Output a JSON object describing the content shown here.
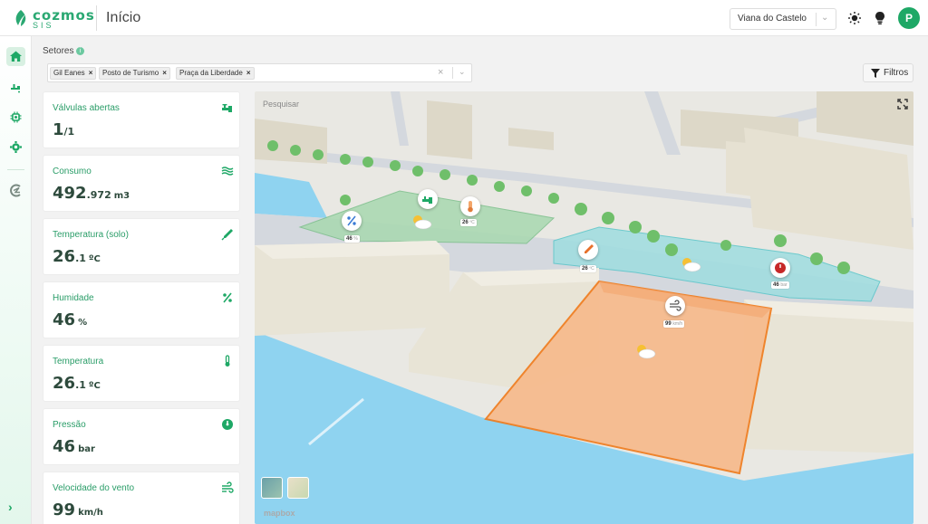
{
  "app": {
    "brand": "cozmos",
    "brand_sub": "SIS",
    "page_title": "Início",
    "user_initial": "P"
  },
  "header": {
    "city": "Viana do Castelo",
    "icons": [
      "sun-icon",
      "lightbulb-icon"
    ]
  },
  "sidebar": {
    "items": [
      "home-icon",
      "irrigation-icon",
      "sensor-icon",
      "settings-icon",
      "cozmos-icon"
    ],
    "expand_icon": "›"
  },
  "filters": {
    "sectors_label": "Setores",
    "info_icon": "i",
    "chips": [
      {
        "label": "Gil Eanes",
        "remove": "×"
      },
      {
        "label": "Posto de Turismo",
        "remove": "×"
      },
      {
        "label": "Praça da Liberdade",
        "remove": "×"
      }
    ],
    "clear": "×",
    "chevron": "⌄",
    "filters_button": "Filtros"
  },
  "cards": [
    {
      "label": "Válvulas abertas",
      "value": "1",
      "dec": "/1",
      "unit": "",
      "icon": "valve-icon"
    },
    {
      "label": "Consumo",
      "value": "492",
      "dec": ".972",
      "unit": "m3",
      "icon": "water-flow-icon"
    },
    {
      "label": "Temperatura (solo)",
      "value": "26",
      "dec": ".1",
      "unit": "ºC",
      "icon": "soil-probe-icon"
    },
    {
      "label": "Humidade",
      "value": "46",
      "dec": "",
      "unit": "%",
      "icon": "percent-icon"
    },
    {
      "label": "Temperatura",
      "value": "26",
      "dec": ".1",
      "unit": "ºC",
      "icon": "thermometer-icon"
    },
    {
      "label": "Pressão",
      "value": "46",
      "dec": "",
      "unit": "bar",
      "icon": "gauge-icon"
    },
    {
      "label": "Velocidade do vento",
      "value": "99",
      "dec": "",
      "unit": "km/h",
      "icon": "wind-icon"
    }
  ],
  "map": {
    "search_placeholder": "Pesquisar",
    "attribution": "mapbox",
    "labels": [
      {
        "value": "46",
        "unit": "%"
      },
      {
        "value": "26",
        "unit": "ºC"
      },
      {
        "value": "26",
        "unit": "ºC"
      },
      {
        "value": "46",
        "unit": "bar"
      },
      {
        "value": "99",
        "unit": "km/h"
      }
    ],
    "colors": {
      "sector_green": "#a8d8b0",
      "sector_teal": "#9fdde0",
      "sector_orange": "#f7b98a",
      "sector_orange_border": "#f07a1a",
      "water": "#8fd3f0"
    }
  }
}
